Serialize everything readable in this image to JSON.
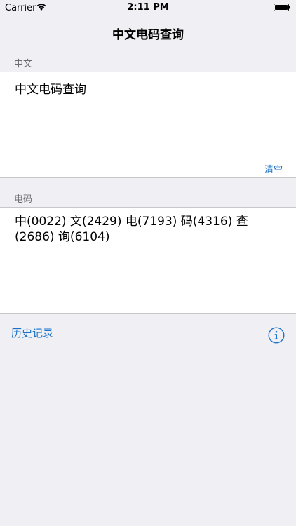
{
  "status_bar": {
    "carrier": "Carrier",
    "time": "2:11 PM"
  },
  "nav": {
    "title": "中文电码查询"
  },
  "input_section": {
    "header": "中文",
    "value": "中文电码查询",
    "clear_label": "清空"
  },
  "output_section": {
    "header": "电码",
    "value": "中(0022) 文(2429) 电(7193) 码(4316) 查(2686) 询(6104)"
  },
  "footer": {
    "history_label": "历史记录",
    "info_icon": "info-icon"
  },
  "colors": {
    "accent": "#1a73c7",
    "background": "#efeff4",
    "secondary_text": "#6d6d72"
  }
}
